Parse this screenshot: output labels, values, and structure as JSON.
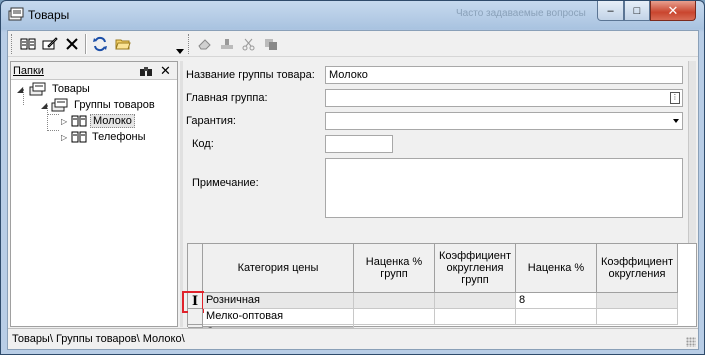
{
  "window": {
    "title": "Товары",
    "background_title": "Часто задаваемые вопросы",
    "close_label": "✕",
    "maximize_label": "□",
    "minimize_label": "–"
  },
  "toolbar": {
    "buttons": [
      {
        "icon": "open-book-icon"
      },
      {
        "icon": "edit-book-icon"
      },
      {
        "icon": "delete-icon"
      },
      {
        "icon": "refresh-icon"
      },
      {
        "icon": "folder-open-icon"
      },
      {
        "icon": "eraser-icon"
      },
      {
        "icon": "stamp-icon"
      },
      {
        "icon": "scissors-icon"
      },
      {
        "icon": "copy-icon"
      }
    ]
  },
  "folders_panel": {
    "title": "Папки",
    "close_label": "✕",
    "tree": [
      {
        "label": "Товары",
        "level": 0,
        "expanded": true
      },
      {
        "label": "Группы товаров",
        "level": 1,
        "expanded": true
      },
      {
        "label": "Молоко",
        "level": 2,
        "expanded": false,
        "selected": true
      },
      {
        "label": "Телефоны",
        "level": 2,
        "expanded": false
      }
    ]
  },
  "form": {
    "group_name_label": "Название группы товара:",
    "group_name_value": "Молоко",
    "main_group_label": "Главная группа:",
    "main_group_value": "",
    "warranty_label": "Гарантия:",
    "warranty_value": "",
    "code_label": "Код:",
    "code_value": "",
    "note_label": "Примечание:",
    "note_value": ""
  },
  "grid": {
    "columns": [
      "Категория цены",
      "Наценка % групп",
      "Коэффициент округления групп",
      "Наценка %",
      "Коэффициент округления"
    ],
    "rows": [
      [
        "Розничная",
        "",
        "",
        "8",
        ""
      ],
      [
        "Мелко-оптовая",
        "",
        "",
        "",
        ""
      ],
      [
        "Оптовая",
        "",
        "",
        "",
        ""
      ]
    ],
    "current_row": 0,
    "row_cursor": "I"
  },
  "status": {
    "path": "Товары\\ Группы товаров\\ Молоко\\"
  }
}
